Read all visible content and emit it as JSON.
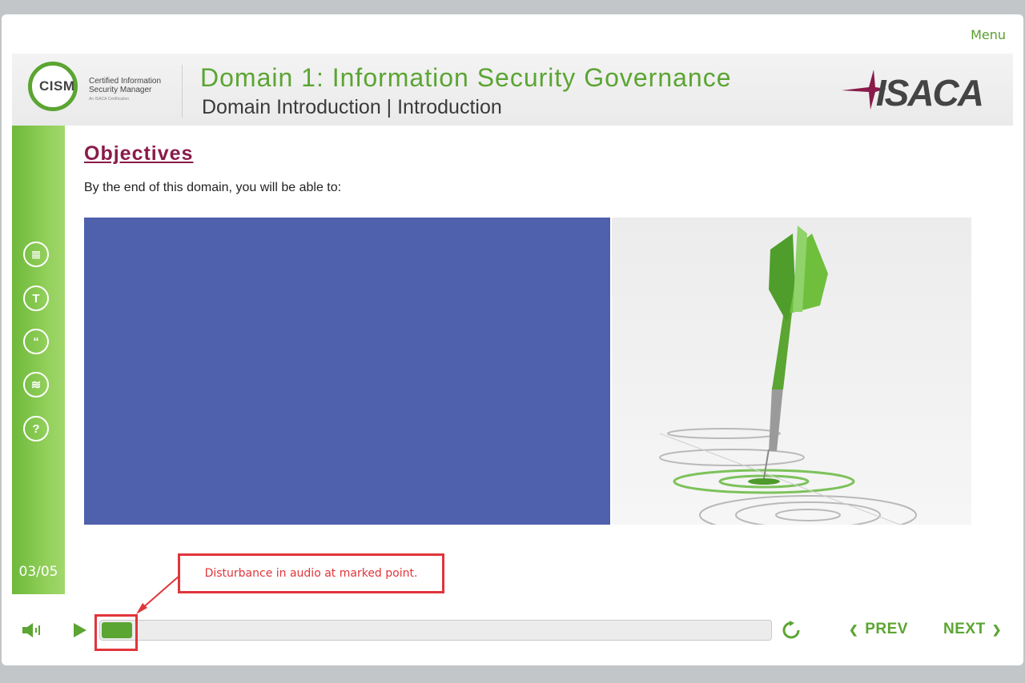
{
  "header": {
    "menu_label": "Menu",
    "cism_logo": {
      "mark": "CISM",
      "line1": "Certified Information",
      "line2": "Security Manager",
      "tagline": "An ISACA Certification"
    },
    "domain_title": "Domain 1: Information Security Governance",
    "domain_subtitle": "Domain Introduction | Introduction",
    "isaca_logo": "ISACA"
  },
  "sidebar": {
    "icons": [
      {
        "name": "notes-icon",
        "glyph": "≣"
      },
      {
        "name": "transcript-icon",
        "glyph": "T"
      },
      {
        "name": "quote-icon",
        "glyph": "“"
      },
      {
        "name": "layers-icon",
        "glyph": "≋"
      },
      {
        "name": "help-icon",
        "glyph": "?"
      }
    ],
    "slide_counter": "03/05"
  },
  "content": {
    "heading": "Objectives",
    "intro": "By the end of this domain, you will be able to:"
  },
  "annotation": {
    "text": "Disturbance in audio at marked point."
  },
  "player": {
    "progress": 0.045,
    "prev_label": "PREV",
    "next_label": "NEXT"
  },
  "colors": {
    "brand_green": "#5ba532",
    "heading_maroon": "#8a1a4a",
    "panel_blue": "#4f60ad",
    "annotation_red": "#e0353b"
  }
}
